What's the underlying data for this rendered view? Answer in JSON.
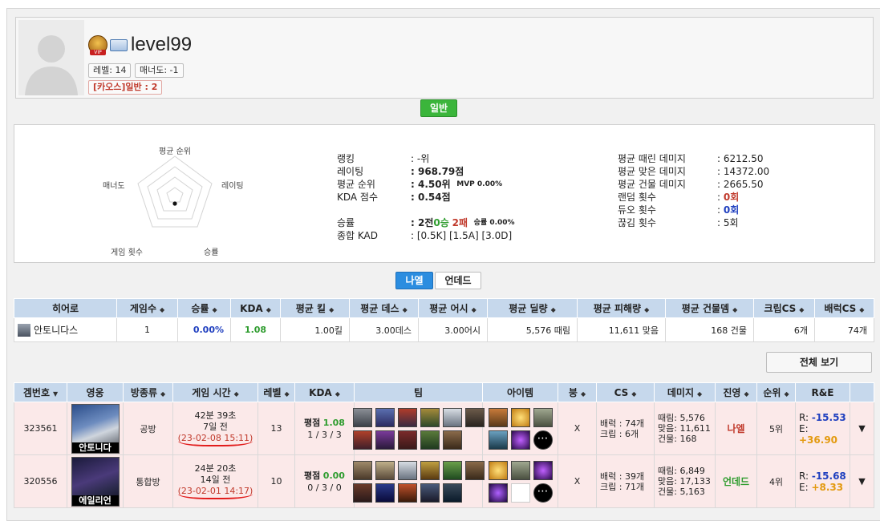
{
  "profile": {
    "username": "level99",
    "vip_badge": "VIP",
    "level_chip": "레벨: 14",
    "manner_chip": "매너도: -1",
    "chaos_chip": "[카오스]일반 : 2"
  },
  "mode_tab": "일반",
  "radar": {
    "labels": {
      "top": "평균 순위",
      "right": "레이팅",
      "bottom_right": "승률",
      "bottom_left": "게임 횟수",
      "left": "매너도"
    }
  },
  "stats_mid": {
    "ranking_k": "랭킹",
    "ranking_v": ": -위",
    "rating_k": "레이팅",
    "rating_v": ": 968.79점",
    "avg_rank_k": "평균 순위",
    "avg_rank_v": ": 4.50위",
    "mvp": "MVP 0.00%",
    "kda_k": "KDA 점수",
    "kda_v": ": 0.54점",
    "winrate_k": "승률",
    "winrate_prefix": ": 2전 ",
    "wins": "0승",
    "losses": "2패",
    "winrate_pct": "승률 0.00%",
    "kad_k": "종합 KAD",
    "kad_v": ": [0.5K] [1.5A] [3.0D]"
  },
  "stats_right": {
    "dealt_k": "평균 때린 데미지",
    "dealt_v": ": 6212.50",
    "taken_k": "평균 맞은 데미지",
    "taken_v": ": 14372.00",
    "building_k": "평균 건물 데미지",
    "building_v": ": 2665.50",
    "random_k": "랜덤 횟수",
    "random_v": "0회",
    "duo_k": "듀오 횟수",
    "duo_v": "0회",
    "dc_k": "끊김 횟수",
    "dc_v": ": 5회",
    "colon": ":"
  },
  "race_tabs": {
    "active": "나엘",
    "other": "언데드"
  },
  "hero_table": {
    "headers": [
      "히어로",
      "게임수",
      "승률",
      "KDA",
      "평균 킬",
      "평균 데스",
      "평균 어시",
      "평균 딜량",
      "평균 피해량",
      "평균 건물뎀",
      "크립CS",
      "배럭CS"
    ],
    "row": [
      "안토니다스",
      "1",
      "0.00%",
      "1.08",
      "1.00킬",
      "3.00데스",
      "3.00어시",
      "5,576 때림",
      "11,611 맞음",
      "168 건물",
      "6개",
      "74개"
    ]
  },
  "view_all": "전체 보기",
  "game_table": {
    "headers": [
      "겜번호",
      "영웅",
      "방종류",
      "게임 시간",
      "레벨",
      "KDA",
      "팀",
      "아이템",
      "붕",
      "CS",
      "데미지",
      "진영",
      "순위",
      "R&E"
    ],
    "rows": [
      {
        "id": "323561",
        "hero_caption": "안토니다",
        "room": "공방",
        "duration": "42분 39초",
        "ago": "7일 전",
        "datetime": "(23-02-08 15:11)",
        "level": "13",
        "kda_score": "평점",
        "kda_value": "1.08",
        "kda_detail": "1 / 3 / 3",
        "bung": "X",
        "cs_barrack": "배럭 : 74개",
        "cs_creep": "크립 : 6개",
        "dmg_dealt": "때림: 5,576",
        "dmg_taken": "맞음: 11,611",
        "dmg_building": "건물: 168",
        "faction": "나엘",
        "rank": "5위",
        "r_label": "R:",
        "r_value": "-15.53",
        "e_label": "E:",
        "e_value": "+36.90"
      },
      {
        "id": "320556",
        "hero_caption": "에일리언",
        "room": "통합방",
        "duration": "24분 20초",
        "ago": "14일 전",
        "datetime": "(23-02-01 14:17)",
        "level": "10",
        "kda_score": "평점",
        "kda_value": "0.00",
        "kda_detail": "0 / 3 / 0",
        "bung": "X",
        "cs_barrack": "배럭 : 39개",
        "cs_creep": "크립 : 71개",
        "dmg_dealt": "때림: 6,849",
        "dmg_taken": "맞음: 17,133",
        "dmg_building": "건물: 5,163",
        "faction": "언데드",
        "rank": "4위",
        "r_label": "R:",
        "r_value": "-15.68",
        "e_label": "E:",
        "e_value": "+8.33"
      }
    ]
  },
  "colors": {
    "header_bg": "#c6d8ec",
    "row_bg": "#fbe9e9",
    "green_tab": "#3bb53b",
    "blue_tab": "#2b8de0"
  }
}
